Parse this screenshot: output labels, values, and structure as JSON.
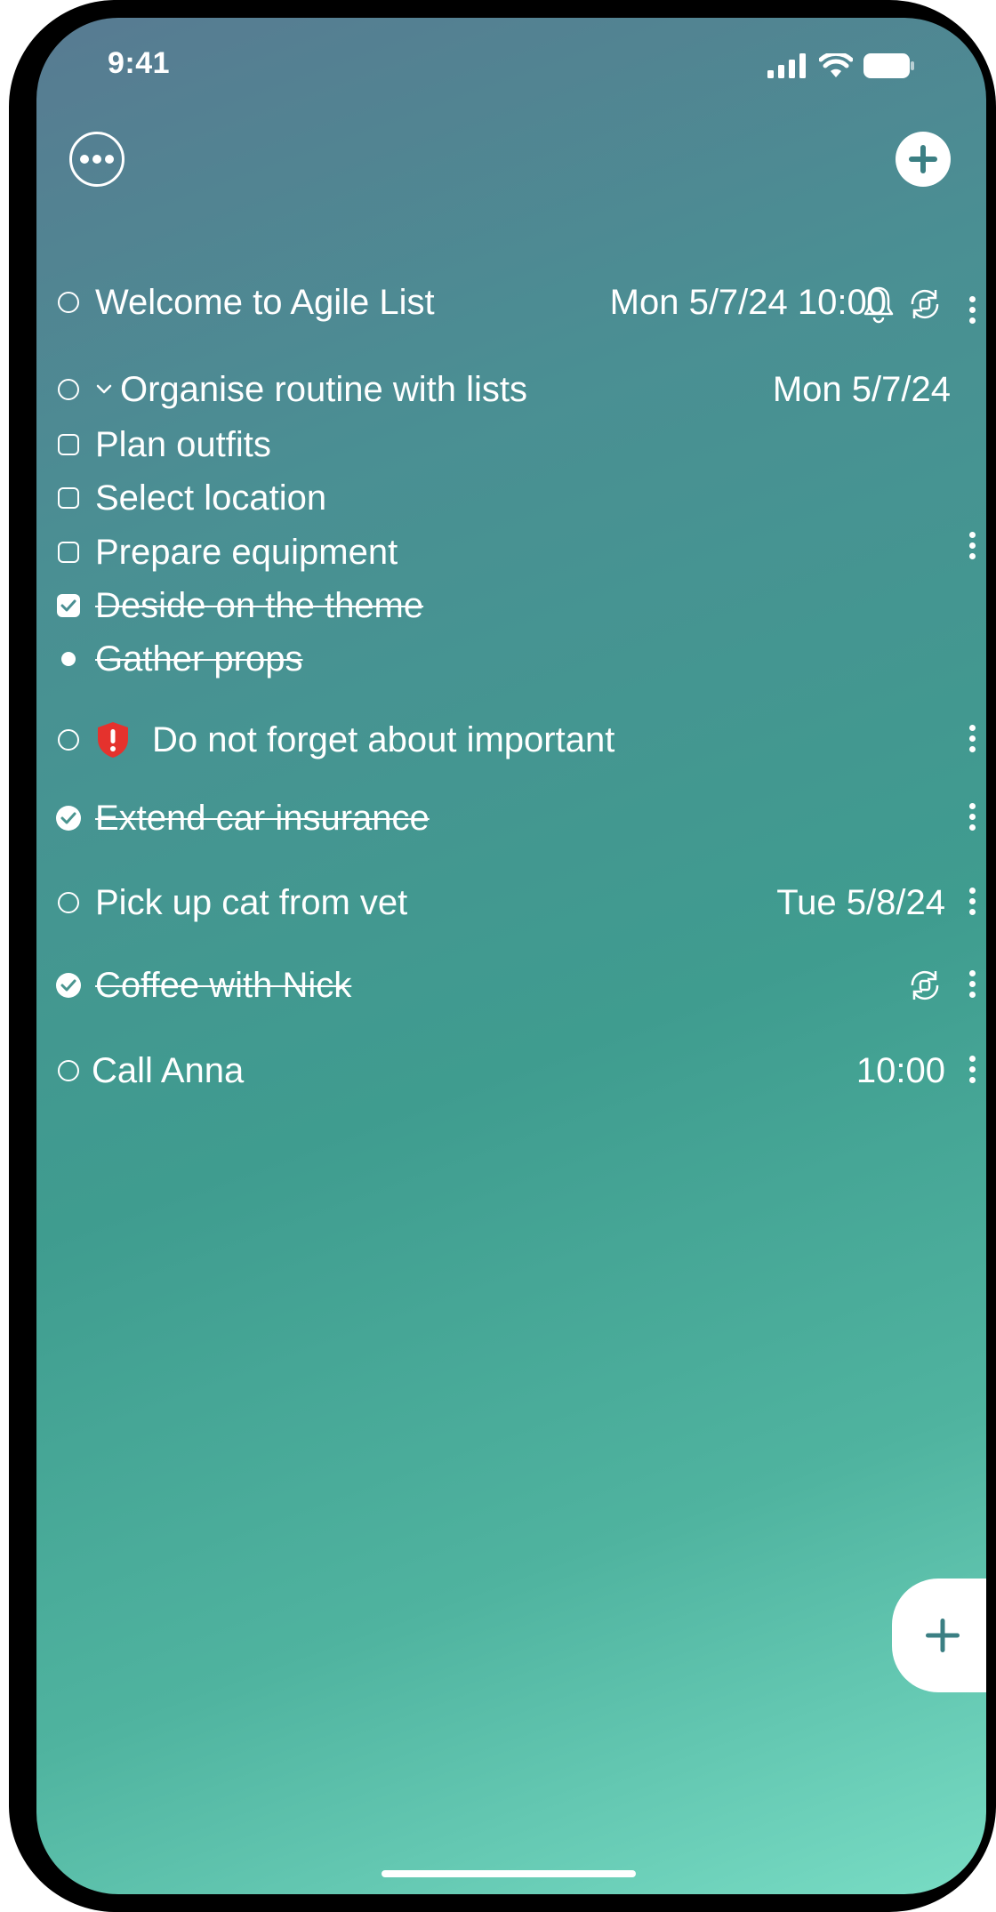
{
  "status_bar": {
    "time": "9:41"
  },
  "tasks": [
    {
      "title": "Welcome to Agile List",
      "date": "Mon 5/7/24 10:00",
      "completed": false,
      "icons": [
        "bell-icon",
        "repeat-icon"
      ]
    },
    {
      "title": "Organise routine with lists",
      "date": "Mon 5/7/24",
      "completed": false,
      "expanded": true,
      "subtasks": [
        {
          "title": "Plan outfits",
          "completed": false
        },
        {
          "title": "Select location",
          "completed": false
        },
        {
          "title": "Prepare equipment",
          "completed": false
        },
        {
          "title": "Deside on the theme",
          "completed": true
        },
        {
          "title": "Gather props",
          "completed": true
        }
      ]
    },
    {
      "title": "Do not forget about important",
      "completed": false,
      "icons": [
        "important-shield-icon"
      ]
    },
    {
      "title": "Extend car insurance",
      "completed": true
    },
    {
      "title": "Pick up cat from vet",
      "date": "Tue 5/8/24",
      "completed": false
    },
    {
      "title": "Coffee with Nick",
      "completed": true,
      "icons": [
        "repeat-icon"
      ]
    },
    {
      "title": "Call Anna",
      "date": "10:00",
      "completed": false
    }
  ],
  "colors": {
    "gradient_top": "#587b92",
    "gradient_mid": "#3f9c8f",
    "gradient_bottom": "#78dcc4",
    "important_red": "#e5322d",
    "accent_teal": "#3b7f83"
  }
}
